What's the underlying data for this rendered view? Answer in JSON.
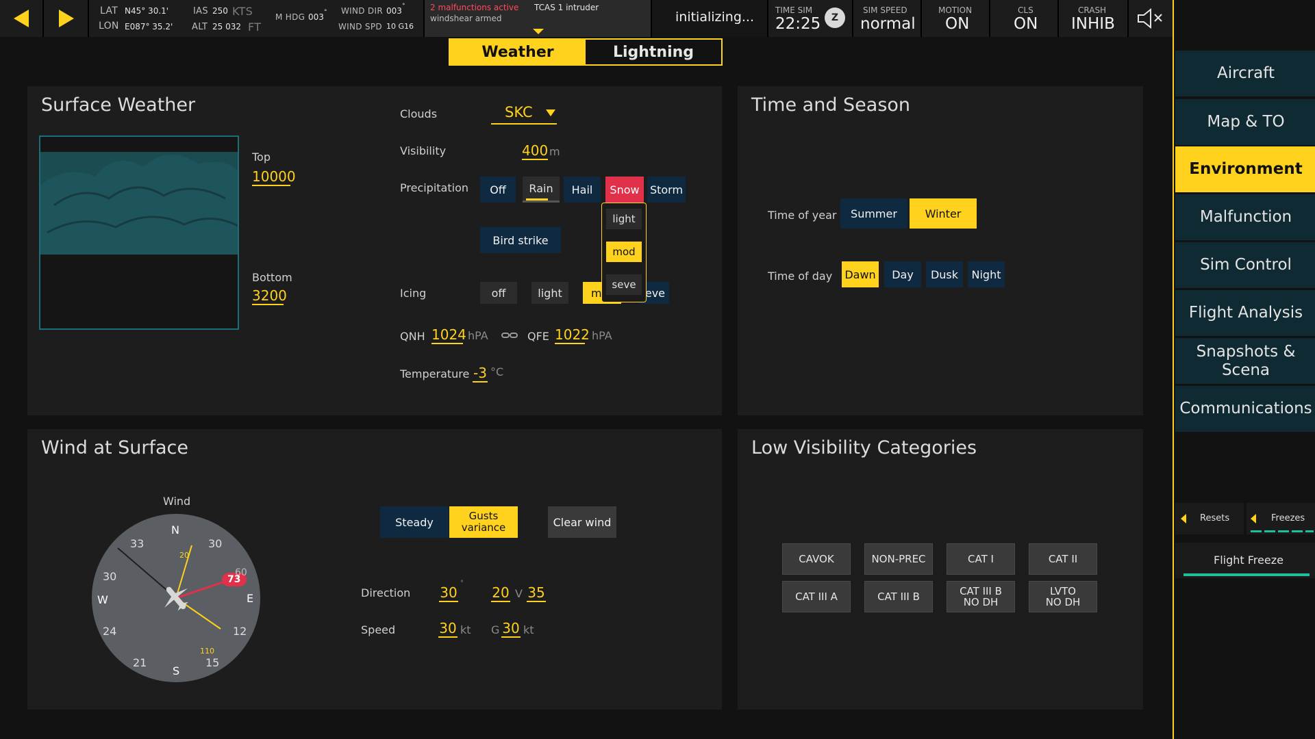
{
  "colors": {
    "accent": "#ffd21e",
    "alert": "#e0304a",
    "panel": "#1d1d1d",
    "button": "#0f2a40"
  },
  "topbar": {
    "position": {
      "lat_label": "LAT",
      "lat_value": "N45°  30.1'",
      "lon_label": "LON",
      "lon_value": "E087°  35.2'"
    },
    "air": {
      "ias_label": "IAS",
      "ias_value": "250",
      "ias_unit": "KTS",
      "alt_label": "ALT",
      "alt_value": "25 032",
      "alt_unit": "FT"
    },
    "heading": {
      "label": "M HDG",
      "value": "003",
      "unit": "°"
    },
    "wind": {
      "dir_label": "WIND DIR",
      "dir_value": "003",
      "dir_unit": "°",
      "spd_label": "WIND SPD",
      "spd_value": "10 G16"
    },
    "alerts": {
      "malfunctions": "2 malfunctions active",
      "tcas": "TCAS 1 intruder",
      "windshear": "windshear armed"
    },
    "status": "initializing...",
    "time": {
      "label": "TIME SIM",
      "value": "22:25",
      "zone": "Z"
    },
    "speed": {
      "label": "SIM SPEED",
      "value": "normal"
    },
    "motion": {
      "label": "MOTION",
      "value": "ON"
    },
    "cls": {
      "label": "CLS",
      "value": "ON"
    },
    "crash": {
      "label": "CRASH",
      "value": "INHIB"
    },
    "icons": [
      "prev-arrow-icon",
      "next-arrow-icon",
      "speaker-mute-icon"
    ]
  },
  "tabs": [
    "Weather",
    "Lightning"
  ],
  "surface_weather": {
    "title": "Surface Weather",
    "top_label": "Top",
    "top_value": "10000",
    "bottom_label": "Bottom",
    "bottom_value": "3200",
    "clouds_label": "Clouds",
    "clouds_value": "SKC",
    "visibility_label": "Visibility",
    "visibility_value": "400",
    "visibility_unit": "m",
    "precip_label": "Precipitation",
    "precip_options": [
      "Off",
      "Rain",
      "Hail",
      "Snow",
      "Storm"
    ],
    "precip_dropdown": [
      "light",
      "mod",
      "seve"
    ],
    "bird_strike": "Bird strike",
    "icing_label": "Icing",
    "icing_options": [
      "off",
      "light",
      "m",
      "eve"
    ],
    "qnh_label": "QNH",
    "qnh_value": "1024",
    "qnh_unit": "hPA",
    "qfe_label": "QFE",
    "qfe_value": "1022",
    "qfe_unit": "hPA",
    "temp_label": "Temperature",
    "temp_value": "-3",
    "temp_unit": "°C"
  },
  "time_season": {
    "title": "Time and Season",
    "year_label": "Time of year",
    "year_options": [
      "Summer",
      "Winter"
    ],
    "day_label": "Time of day",
    "day_options": [
      "Dawn",
      "Day",
      "Dusk",
      "Night"
    ]
  },
  "wind": {
    "title": "Wind at Surface",
    "compass_label": "Wind",
    "compass": {
      "n": "N",
      "s": "S",
      "e": "E",
      "w": "W",
      "t33": "33",
      "t30a": "30",
      "t30b": "30",
      "t24": "24",
      "t21": "21",
      "t15": "15",
      "t12": "12",
      "t60": "60",
      "m20": "20",
      "m110": "110",
      "badge": "73"
    },
    "steady": "Steady",
    "gusts": "Gusts\nvariance",
    "clear": "Clear wind",
    "direction_label": "Direction",
    "direction_value": "30",
    "direction_unit": "°",
    "var_from": "20",
    "var_sep": "V",
    "var_to": "35",
    "speed_label": "Speed",
    "speed_value": "30",
    "speed_unit": "kt",
    "gust_label": "G",
    "gust_value": "30",
    "gust_unit": "kt"
  },
  "low_vis": {
    "title": "Low Visibility Categories",
    "row1": [
      "CAVOK",
      "NON-PREC",
      "CAT I",
      "CAT II"
    ],
    "row2": [
      "CAT III A",
      "CAT III B",
      "CAT III  B\nNO DH",
      "LVTO\nNO DH"
    ]
  },
  "sidebar": {
    "items": [
      "Aircraft",
      "Map & TO",
      "Environment",
      "Malfunction",
      "Sim Control",
      "Flight Analysis",
      "Snapshots &\nScena",
      "Communications"
    ],
    "resets": "Resets",
    "freezes": "Freezes",
    "flight_freeze": "Flight Freeze"
  }
}
